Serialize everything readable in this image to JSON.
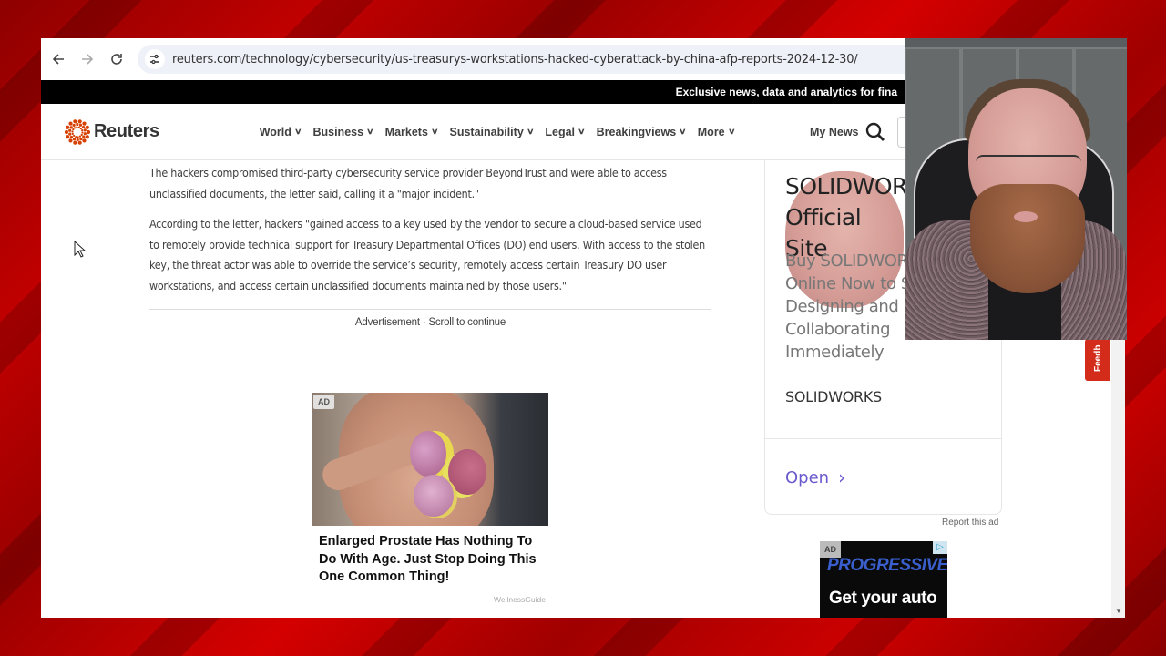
{
  "browser": {
    "url": "reuters.com/technology/cybersecurity/us-treasurys-workstations-hacked-cyberattack-by-china-afp-reports-2024-12-30/",
    "icons": {
      "back": "arrow-left-icon",
      "forward": "arrow-right-icon",
      "reload": "reload-icon",
      "site_info": "tune-icon"
    }
  },
  "promo_bar": {
    "text": "Exclusive news, data and analytics for fina"
  },
  "header": {
    "logo_text": "Reuters",
    "nav": [
      {
        "label": "World"
      },
      {
        "label": "Business"
      },
      {
        "label": "Markets"
      },
      {
        "label": "Sustainability"
      },
      {
        "label": "Legal"
      },
      {
        "label": "Breakingviews"
      },
      {
        "label": "More"
      }
    ],
    "my_news": "My News",
    "brand_color": "#d64000"
  },
  "article": {
    "paragraphs": [
      "The hackers compromised third-party cybersecurity service provider BeyondTrust and were able to access unclassified documents, the letter said, calling it a \"major incident.\"",
      "According to the letter, hackers \"gained access to a key used by the vendor to secure a cloud-based service used to remotely provide technical support for Treasury Departmental Offices (DO) end users. With access to the stolen key, the threat actor was able to override the service’s security, remotely access certain Treasury DO user workstations, and access certain unclassified documents maintained by those users.\""
    ]
  },
  "inline_ad": {
    "caption": "Advertisement · Scroll to continue",
    "badge": "AD",
    "title": "Enlarged Prostate Has Nothing To Do With Age. Just Stop Doing This One Common Thing!",
    "source": "WellnessGuide"
  },
  "side_ad": {
    "headline": "SOLIDWOR\nOfficial Site",
    "headline_line1": "SOLIDWOR",
    "headline_line2": "Official Site",
    "description_lines": [
      "Buy SOLIDWOR",
      "Online Now to S",
      "Designing and",
      "Collaborating",
      "Immediately"
    ],
    "brand": "SOLIDWORKS",
    "cta": "Open",
    "cta_color": "#6a5acd",
    "report": "Report this ad"
  },
  "progressive_ad": {
    "badge": "AD",
    "logo": "PROGRESSIVE",
    "tagline": "Get your auto"
  },
  "feedback": {
    "label": "Feedb",
    "color": "#d42c1a"
  },
  "webcam": {
    "description": "streamer webcam overlay"
  }
}
